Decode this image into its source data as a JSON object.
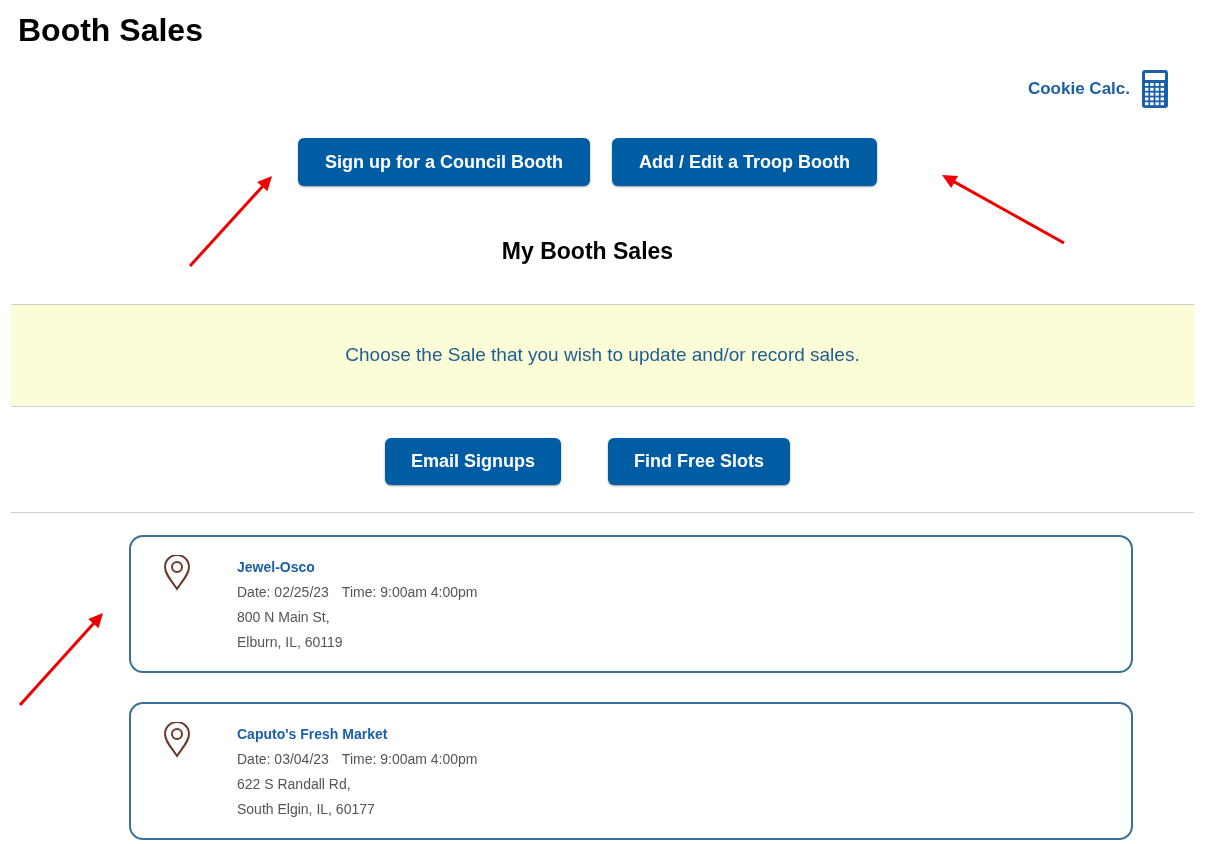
{
  "page_title": "Booth Sales",
  "cookie_calc_link": "Cookie Calc.",
  "top_buttons": [
    "Sign up for a Council Booth",
    "Add / Edit a Troop Booth"
  ],
  "section_heading": "My Booth Sales",
  "notice": "Choose the Sale that you wish to update and/or record sales.",
  "action_buttons": [
    "Email Signups",
    "Find Free Slots"
  ],
  "booths": [
    {
      "name": "Jewel-Osco",
      "date": "Date: 02/25/23",
      "time": "Time: 9:00am 4:00pm",
      "address_line_1": "800 N Main St,",
      "address_line_2": "Elburn, IL, 60119"
    },
    {
      "name": "Caputo's Fresh Market",
      "date": "Date: 03/04/23",
      "time": "Time: 9:00am 4:00pm",
      "address_line_1": "622 S Randall Rd,",
      "address_line_2": "South Elgin, IL, 60177"
    }
  ]
}
